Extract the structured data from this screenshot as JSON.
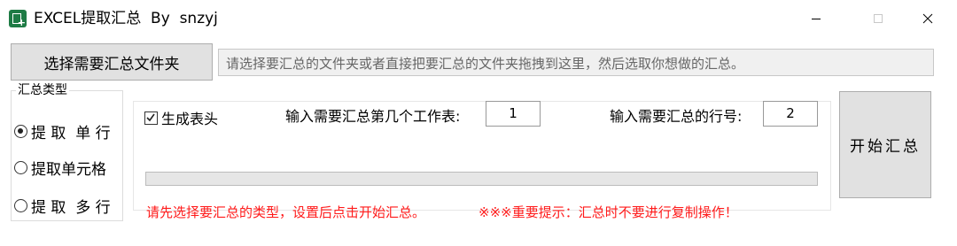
{
  "window": {
    "title": "EXCEL提取汇总  By  snzyj",
    "icon": "excel-sheet-icon"
  },
  "toolbar": {
    "choose_folder_label": "选择需要汇总文件夹",
    "path_placeholder": "请选择要汇总的文件夹或者直接把要汇总的文件夹拖拽到这里，然后选取你想做的汇总。"
  },
  "summary_type": {
    "legend": "汇总类型",
    "options": [
      {
        "label": "提 取  单 行",
        "checked": true
      },
      {
        "label": "提取单元格",
        "checked": false
      },
      {
        "label": "提 取  多 行",
        "checked": false
      }
    ]
  },
  "settings": {
    "generate_header_label": "生成表头",
    "generate_header_checked": true,
    "sheet_index_label": "输入需要汇总第几个工作表:",
    "sheet_index_value": "1",
    "row_number_label": "输入需要汇总的行号:",
    "row_number_value": "2",
    "progress_percent": 0
  },
  "messages": {
    "instruction": "请先选择要汇总的类型，设置后点击开始汇总。",
    "warning": "※※※重要提示：汇总时不要进行复制操作！"
  },
  "start_button_label": "开始汇总",
  "colors": {
    "warning_text": "#ff1a1a",
    "button_bg": "#e1e1e1",
    "app_icon": "#1e7b45"
  }
}
